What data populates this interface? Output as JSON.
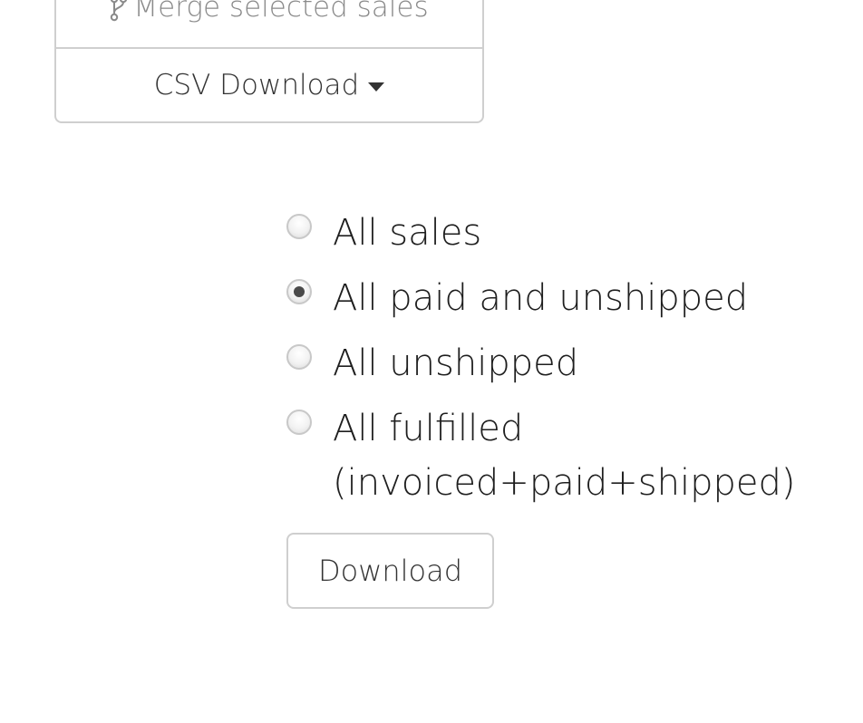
{
  "actions": {
    "merge_label": "Merge selected sales",
    "merge_icon": "merge-branch-icon",
    "csv_label": "CSV Download",
    "csv_icon": "caret-down-icon"
  },
  "csv_options": {
    "selected": "All paid and unshipped",
    "items": [
      {
        "label": "All sales",
        "checked": false
      },
      {
        "label": "All paid and unshipped",
        "checked": true
      },
      {
        "label": "All unshipped",
        "checked": false
      },
      {
        "label": "All fulfilled (invoiced+paid+shipped)",
        "checked": false
      }
    ],
    "download_label": "Download"
  }
}
